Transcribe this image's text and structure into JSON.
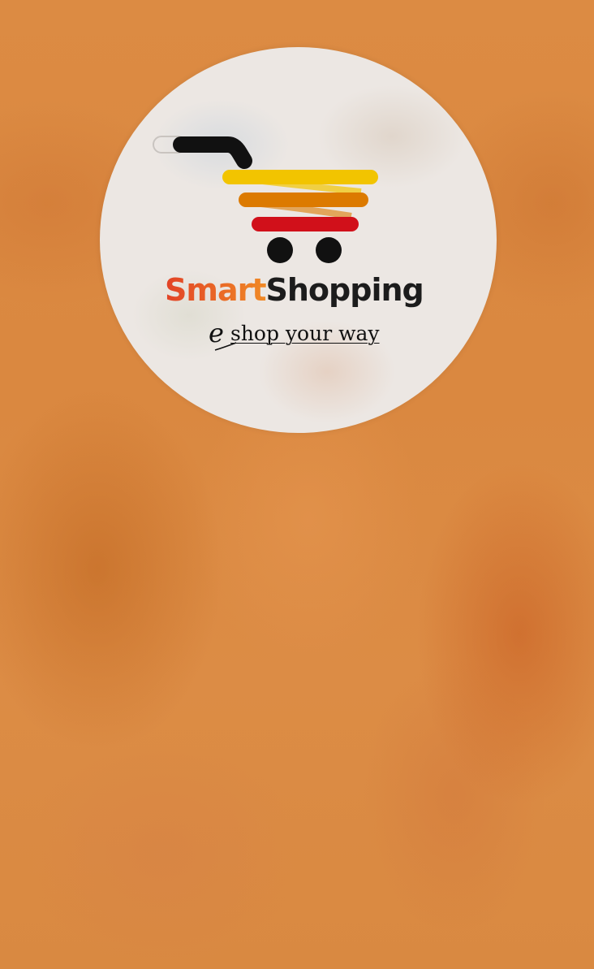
{
  "splash": {
    "brand": {
      "part1": "Smart",
      "part2": "Shopping"
    },
    "tagline": {
      "prefix": "e",
      "text": "shop your way"
    },
    "logo_icon": "shopping-cart-icon",
    "colors": {
      "background": "#de8c45",
      "circle": "#ece7e3",
      "cart_handle": "#111111",
      "cart_line_yellow": "#f2c400",
      "cart_line_orange": "#dc7a00",
      "cart_line_red": "#d1101a",
      "brand_smart": "#e2462a",
      "brand_shopping": "#1c1c1c"
    }
  }
}
